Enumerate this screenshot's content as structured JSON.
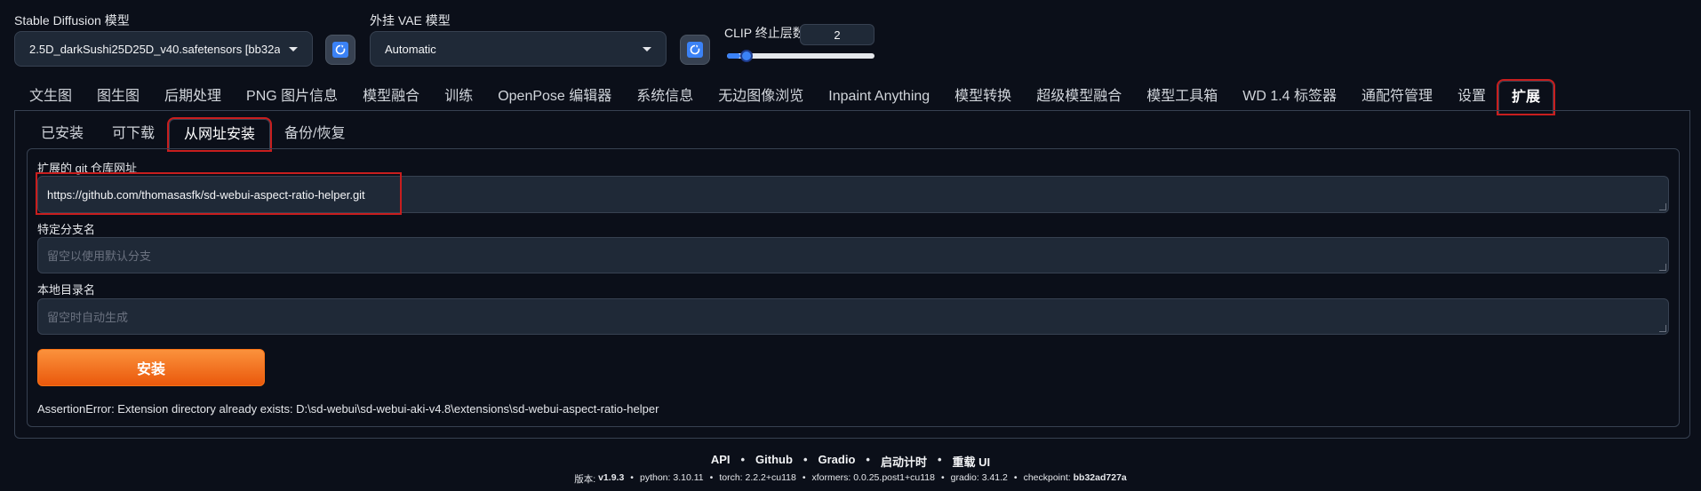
{
  "top": {
    "sd_model": {
      "label": "Stable Diffusion 模型",
      "value": "2.5D_darkSushi25D25D_v40.safetensors [bb32a"
    },
    "vae": {
      "label": "外挂 VAE 模型",
      "value": "Automatic"
    },
    "clip": {
      "label": "CLIP 终止层数",
      "value": "2",
      "slider_min": 1,
      "slider_max": 12,
      "slider_value": 2
    }
  },
  "main_tabs": [
    "文生图",
    "图生图",
    "后期处理",
    "PNG 图片信息",
    "模型融合",
    "训练",
    "OpenPose 编辑器",
    "系统信息",
    "无边图像浏览",
    "Inpaint Anything",
    "模型转换",
    "超级模型融合",
    "模型工具箱",
    "WD 1.4 标签器",
    "通配符管理",
    "设置",
    "扩展"
  ],
  "sub_tabs": [
    "已安装",
    "可下载",
    "从网址安装",
    "备份/恢复"
  ],
  "form": {
    "repo_label": "扩展的 git 仓库网址",
    "repo_value": "https://github.com/thomasasfk/sd-webui-aspect-ratio-helper.git",
    "branch_label": "特定分支名",
    "branch_placeholder": "留空以使用默认分支",
    "dir_label": "本地目录名",
    "dir_placeholder": "留空时自动生成",
    "install_label": "安装",
    "error": "AssertionError: Extension directory already exists: D:\\sd-webui\\sd-webui-aki-v4.8\\extensions\\sd-webui-aspect-ratio-helper"
  },
  "footer": {
    "links": [
      "API",
      "Github",
      "Gradio",
      "启动计时",
      "重载 UI"
    ],
    "version_label": "版本:",
    "version": "v1.9.3",
    "python_label": "python:",
    "python": "3.10.11",
    "torch_label": "torch:",
    "torch": "2.2.2+cu118",
    "xformers_label": "xformers:",
    "xformers": "0.0.25.post1+cu118",
    "gradio_label": "gradio:",
    "gradio": "3.41.2",
    "checkpoint_label": "checkpoint:",
    "checkpoint": "bb32ad727a"
  },
  "colors": {
    "accent": "#f97316",
    "highlight": "#c81e1e",
    "slider": "#3b82f6",
    "bg": "#0b0f19"
  }
}
